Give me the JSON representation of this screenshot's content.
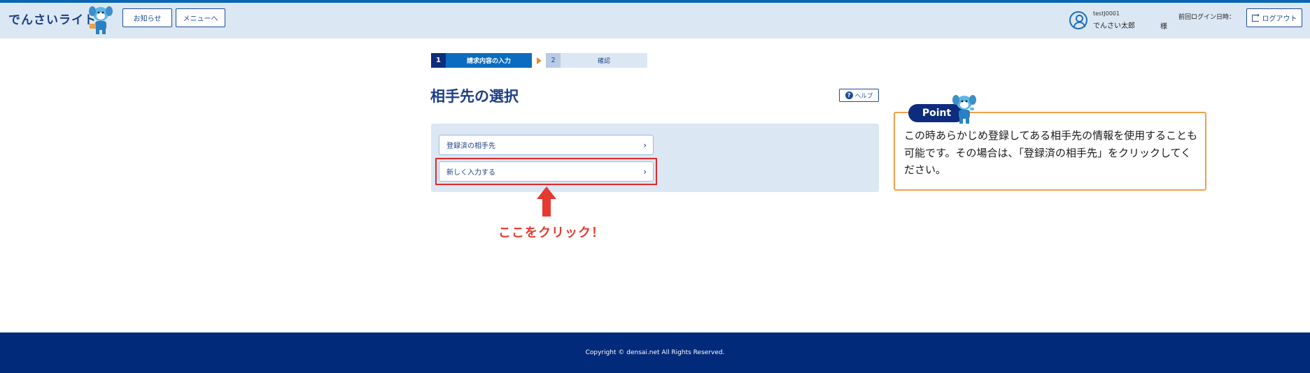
{
  "header": {
    "brand": "でんさいライト",
    "news_button": "お知らせ",
    "menu_button": "メニューへ",
    "user_id": "testJ0001",
    "user_name": "でんさい太郎",
    "user_suffix": "様",
    "last_login_label": "前回ログイン日時：",
    "logout_button": "ログアウト"
  },
  "steps": [
    {
      "number": "1",
      "label": "請求内容の入力",
      "active": true
    },
    {
      "number": "2",
      "label": "確認",
      "active": false
    }
  ],
  "page": {
    "title": "相手先の選択",
    "help_button": "ヘルプ"
  },
  "options": {
    "registered": "登録済の相手先",
    "new_entry": "新しく入力する"
  },
  "annotation": {
    "click_here": "ここをクリック！"
  },
  "point": {
    "badge": "Point",
    "text": "この時あらかじめ登録してある相手先の情報を使用することも可能です。その場合は、「登録済の相手先」をクリックしてください。"
  },
  "footer": {
    "copyright": "Copyright © densai.net All Rights Reserved."
  },
  "colors": {
    "header_bg": "#dbe7f3",
    "brand": "#1d3f86",
    "step_active": "#0a6cbf",
    "footer_bg": "#012a7a",
    "point_border": "#f0a04a",
    "annotation_red": "#e53a30"
  }
}
